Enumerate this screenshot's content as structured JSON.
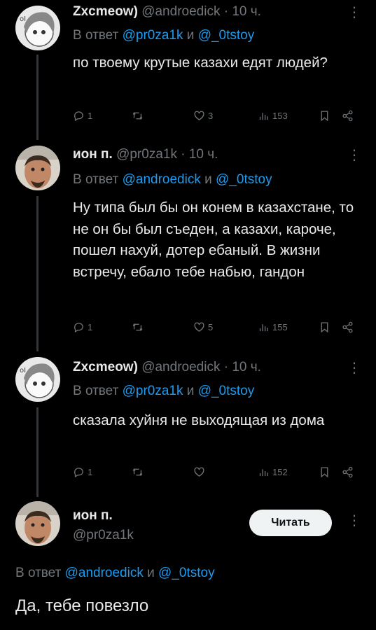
{
  "tweets": [
    {
      "name": "Zxcmeow)",
      "meta": "@androedick · 10 ч.",
      "reply_prefix": "В ответ",
      "mention1": "@pr0za1k",
      "reply_and": "и",
      "mention2": "@_0tstoy",
      "text": "по твоему крутые казахи едят людей?",
      "replies": "1",
      "retweets": "",
      "likes": "3",
      "views": "153"
    },
    {
      "name": "ион п.",
      "meta": "@pr0za1k · 10 ч.",
      "reply_prefix": "В ответ",
      "mention1": "@androedick",
      "reply_and": "и",
      "mention2": "@_0tstoy",
      "text": "Ну типа был бы он конем в казахстане, то не он бы был съеден, а казахи, кароче, пошел нахуй, дотер ебаный. В жизни встречу, ебало тебе набью, гандон",
      "replies": "1",
      "retweets": "",
      "likes": "5",
      "views": "155"
    },
    {
      "name": "Zxcmeow)",
      "meta": "@androedick · 10 ч.",
      "reply_prefix": "В ответ",
      "mention1": "@pr0za1k",
      "reply_and": "и",
      "mention2": "@_0tstoy",
      "text": "сказала хуйня не выходящая из дома",
      "replies": "1",
      "retweets": "",
      "likes": "",
      "views": "152"
    }
  ],
  "main": {
    "name": "ион п.",
    "handle": "@pr0za1k",
    "follow_label": "Читать",
    "reply_prefix": "В ответ",
    "mention1": "@androedick",
    "reply_and": "и",
    "mention2": "@_0tstoy",
    "text": "Да, тебе повезло"
  },
  "colors": {
    "background": "#000000",
    "text": "#e7e9ea",
    "muted": "#71767b",
    "link": "#1d9bf0"
  },
  "icons": [
    "reply-icon",
    "retweet-icon",
    "like-icon",
    "views-icon",
    "bookmark-icon",
    "share-icon",
    "more-icon"
  ]
}
